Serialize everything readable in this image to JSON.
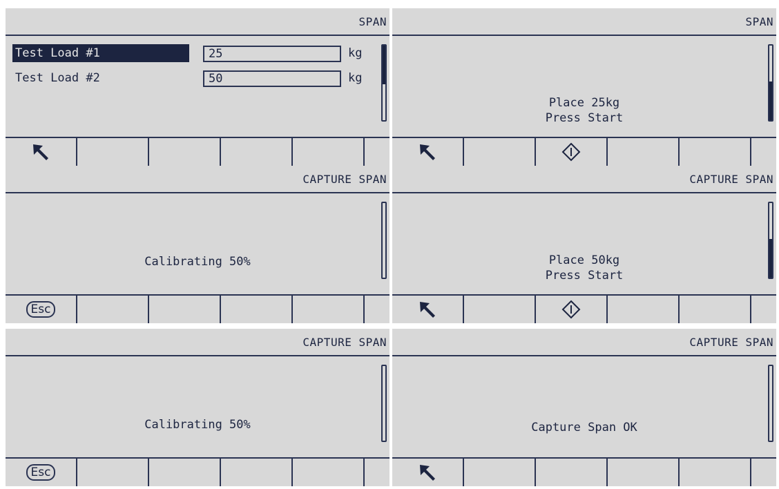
{
  "screens": [
    {
      "title": "SPAN",
      "fields": [
        {
          "label": "Test Load #1",
          "value": "25",
          "unit": "kg"
        },
        {
          "label": "Test Load #2",
          "value": "50",
          "unit": "kg"
        }
      ],
      "softkeys": [
        "back-arrow-icon",
        "",
        "",
        "",
        "",
        ""
      ]
    },
    {
      "title": "SPAN",
      "message_lines": [
        "Place 25kg",
        "Press Start"
      ],
      "softkeys": [
        "back-arrow-icon",
        "",
        "start-icon",
        "",
        "",
        ""
      ]
    },
    {
      "title": "CAPTURE SPAN",
      "message_lines": [
        "Calibrating 50%"
      ],
      "softkeys": [
        "esc-icon",
        "",
        "",
        "",
        "",
        ""
      ],
      "esc_label": "Esc"
    },
    {
      "title": "CAPTURE SPAN",
      "message_lines": [
        "Place 50kg",
        "Press Start"
      ],
      "softkeys": [
        "back-arrow-icon",
        "",
        "start-icon",
        "",
        "",
        ""
      ]
    },
    {
      "title": "CAPTURE SPAN",
      "message_lines": [
        "Calibrating 50%"
      ],
      "softkeys": [
        "esc-icon",
        "",
        "",
        "",
        "",
        ""
      ],
      "esc_label": "Esc"
    },
    {
      "title": "CAPTURE SPAN",
      "message_lines": [
        "Capture Span OK"
      ],
      "softkeys": [
        "back-arrow-icon",
        "",
        "",
        "",
        "",
        ""
      ]
    }
  ]
}
